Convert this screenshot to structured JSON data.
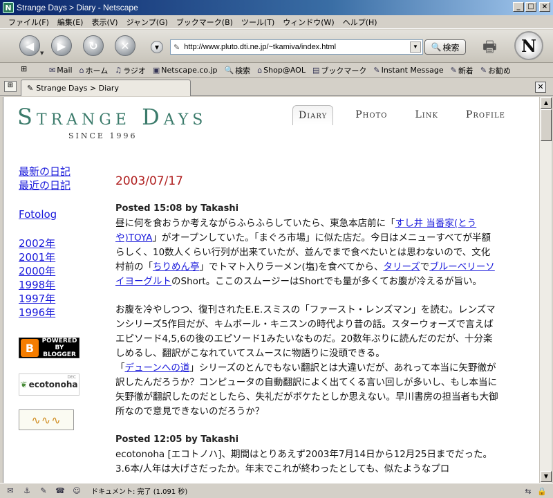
{
  "window": {
    "title": "Strange Days > Diary - Netscape"
  },
  "menu": [
    "ファイル(F)",
    "編集(E)",
    "表示(V)",
    "ジャンプ(G)",
    "ブックマーク(B)",
    "ツール(T)",
    "ウィンドウ(W)",
    "ヘルプ(H)"
  ],
  "toolbar": {
    "url": "http://www.pluto.dti.ne.jp/~tkamiva/index.html",
    "search_label": "検索"
  },
  "personal": [
    "Mail",
    "ホーム",
    "ラジオ",
    "Netscape.co.jp",
    "検索",
    "Shop@AOL",
    "ブックマーク",
    "Instant Message",
    "新着",
    "お勧め"
  ],
  "tab": {
    "label": "Strange Days > Diary"
  },
  "site": {
    "logo": "Strange Days",
    "since": "SINCE 1996",
    "nav": [
      "Diary",
      "Photo",
      "Link",
      "Profile"
    ]
  },
  "sidebar": {
    "diary_links": [
      "最新の日記",
      "最近の日記"
    ],
    "fotolog": "Fotolog",
    "years": [
      "2002年",
      "2001年",
      "2000年",
      "1998年",
      "1997年",
      "1996年"
    ],
    "blogger_badge": [
      "POWERED BY",
      "BLOGGER"
    ],
    "ecotonoha": "ecotonoha",
    "ecotonoha_dec": "DEC"
  },
  "main": {
    "date": "2003/07/17",
    "post1": {
      "posted": "Posted 15:08 by Takashi",
      "p1_a": "昼に何を食おうか考えながらふらふらしていたら、東急本店前に「",
      "p1_link1": "すし井 当番家(とうや)TOYA",
      "p1_b": "」がオープンしていた。「まぐろ市場」に似た店だ。今日はメニューすべてが半額らしく、10数人くらい行列が出来ていたが、並んでまで食べたいとは思わないので、文化村前の「",
      "p1_link2": "ちりめん亭",
      "p1_c": "」でトマト入りラーメン(塩)を食べてから、",
      "p1_link3": "タリーズ",
      "p1_d": "で",
      "p1_link4": "ブルーベリーソイヨーグルト",
      "p1_e": "のShort。ここのスムージーはShortでも量が多くてお腹が冷えるが旨い。",
      "p2_a": "お腹を冷やしつつ、復刊されたE.E.スミスの「ファースト・レンズマン」を読む。レンズマンシリーズ5作目だが、キムボール・キニスンの時代より昔の話。スターウォーズで言えばエピソード4,5,6の後のエピソード1みたいなものだ。20数年ぶりに読んだのだが、十分楽しめるし、翻訳がこなれていてスムースに物語りに没頭できる。",
      "p2_link": "デューンへの道",
      "p2_b": "」シリーズのとんでもない翻訳とは大違いだが、あれって本当に矢野徹が訳したんだろうか？コンピュータの自動翻訳によく出てくる言い回しが多いし、もし本当に矢野徹が翻訳したのだとしたら、失礼だがボケたとしか思えない。早川書房の担当者も大御所なので意見できないのだろうか？",
      "p2_open": "「"
    },
    "post2": {
      "posted": "Posted 12:05 by Takashi",
      "p1": "ecotonoha [エコトノハ]、期間はとりあえず2003年7月14日から12月25日までだった。3.6本/人年は大げさだったか。年末でこれが終わったとしても、似たようなプロ"
    }
  },
  "status": {
    "text": "ドキュメント: 完了 (1.091 秒)"
  }
}
